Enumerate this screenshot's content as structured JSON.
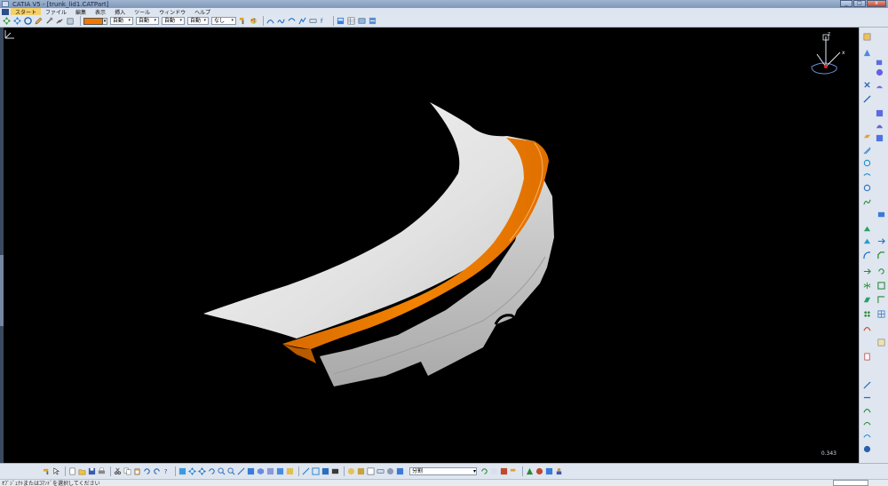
{
  "window": {
    "title": "CATIA V5 - [trunk_lid1.CATPart]",
    "minimize": "_",
    "maximize": "□",
    "close": "x"
  },
  "menu": [
    "スタート",
    "ファイル",
    "編集",
    "表示",
    "挿入",
    "ツール",
    "ウィンドウ",
    "ヘルプ"
  ],
  "toolbar": {
    "fill_color": "#f07800",
    "transparency": "自動",
    "line_thickness": "自動",
    "line_type": "自動",
    "point_symbol": "自動",
    "rendering_style": "なし"
  },
  "viewport": {
    "scale_readout": "0.343",
    "model": {
      "body_color": "#e8e8e8",
      "spoiler_color": "#f07800"
    },
    "compass_axes": {
      "z": "z",
      "x": "x"
    }
  },
  "bottom_toolbar": {
    "view_dropdown": "分割"
  },
  "status": {
    "message": "ｵﾌﾞｼﾞｪｸﾄまたはｺﾏﾝﾄﾞを選択してください"
  }
}
